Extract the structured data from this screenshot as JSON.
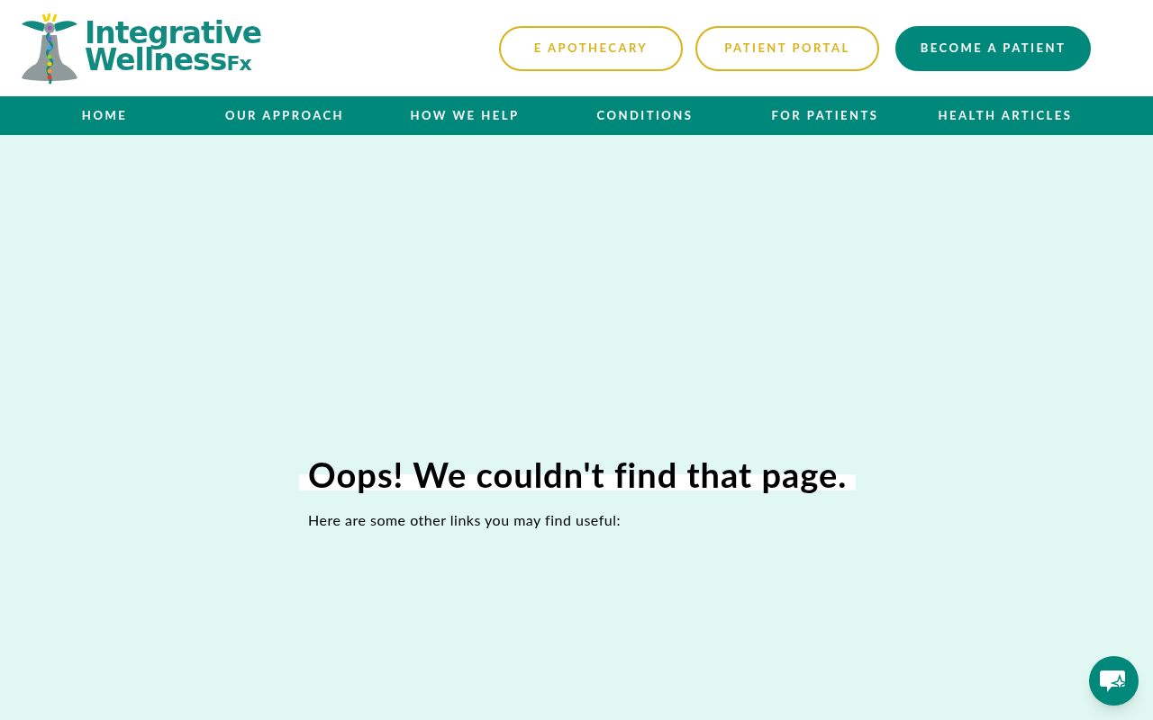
{
  "logo": {
    "line_1": "Integrative",
    "line_2": "Wellness",
    "line_2_suffix": "Fx"
  },
  "header_buttons": [
    {
      "label": "E APOTHECARY",
      "kind": "outline"
    },
    {
      "label": "PATIENT PORTAL",
      "kind": "outline"
    },
    {
      "label": "BECOME A PATIENT",
      "kind": "solid"
    }
  ],
  "nav": [
    "HOME",
    "OUR APPROACH",
    "HOW WE HELP",
    "CONDITIONS",
    "FOR PATIENTS",
    "HEALTH ARTICLES"
  ],
  "heading": "Oops! We couldn't find that page.",
  "subtext": "Here are some other links you may find useful:"
}
